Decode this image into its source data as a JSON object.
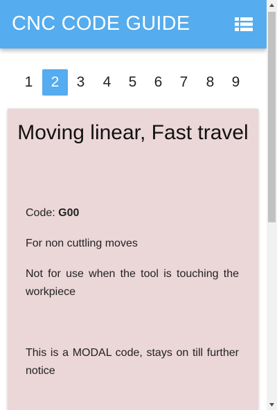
{
  "app": {
    "title": "CNC CODE GUIDE",
    "menu_icon": "list-icon",
    "accent_color": "#55acee"
  },
  "pagination": {
    "pages": [
      "1",
      "2",
      "3",
      "4",
      "5",
      "6",
      "7",
      "8",
      "9"
    ],
    "active": "2"
  },
  "card": {
    "background": "#ebd6d8",
    "title": "Moving linear, Fast travel",
    "code_label": "Code: ",
    "code_value": "G00",
    "paragraphs": [
      "For non cuttling moves",
      "Not for use when the tool is touching the workpiece",
      "This is a MODAL code, stays on till further notice"
    ]
  },
  "scrollbar": {
    "up_icon": "arrow-up-icon",
    "down_icon": "arrow-down-icon"
  }
}
